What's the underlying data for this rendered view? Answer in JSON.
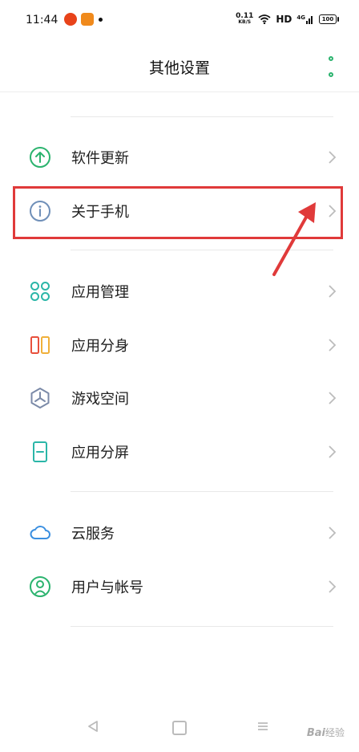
{
  "status_bar": {
    "time": "11:44",
    "net_speed": "0.11",
    "net_speed_unit": "KB/S",
    "hd": "HD",
    "signal": "4G",
    "battery": "100"
  },
  "header": {
    "title": "其他设置",
    "menu_icon": "more-vertical-icon"
  },
  "items": [
    {
      "label": "软件更新",
      "icon": "update-arrow-icon"
    },
    {
      "label": "关于手机",
      "icon": "info-icon"
    },
    {
      "label": "应用管理",
      "icon": "app-grid-icon"
    },
    {
      "label": "应用分身",
      "icon": "app-clone-icon"
    },
    {
      "label": "游戏空间",
      "icon": "game-space-icon"
    },
    {
      "label": "应用分屏",
      "icon": "split-screen-icon"
    },
    {
      "label": "云服务",
      "icon": "cloud-icon"
    },
    {
      "label": "用户与帐号",
      "icon": "user-account-icon"
    }
  ],
  "watermark": {
    "brand": "Bai",
    "suffix": "经验"
  },
  "colors": {
    "accent_green": "#2bb36e",
    "highlight_red": "#e03a3a"
  }
}
